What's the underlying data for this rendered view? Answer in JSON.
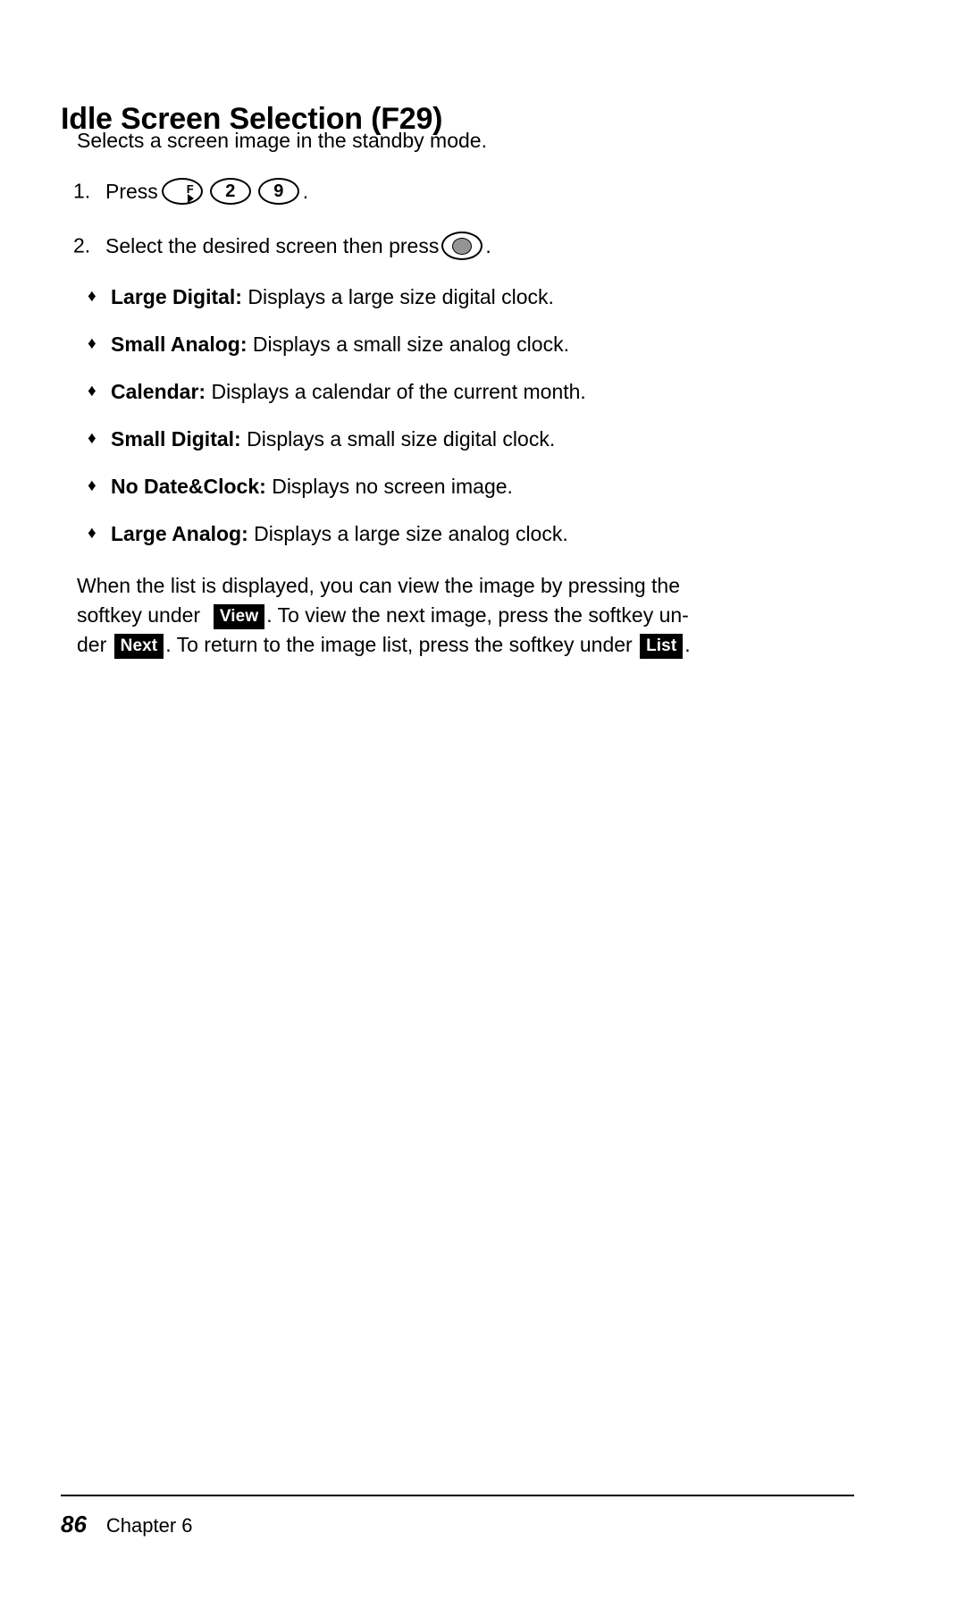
{
  "document": {
    "title": "Idle Screen Selection (F29)",
    "intro": "Selects a screen image in the standby mode."
  },
  "steps": [
    {
      "number": "1.",
      "lead": "Press",
      "keys": [
        {
          "icon": "func-key-icon",
          "label": "F",
          "has_arrow": true
        },
        {
          "icon": "number-key-2-icon",
          "label": "2",
          "has_arrow": false
        },
        {
          "icon": "number-key-9-icon",
          "label": "9",
          "has_arrow": false
        }
      ],
      "tail": "."
    },
    {
      "number": "2.",
      "lead": "Select the desired screen then press",
      "round_key": "select-round-key-icon",
      "tail": "."
    }
  ],
  "options": [
    {
      "bullet": "♦",
      "term": "Large Digital:",
      "desc": " Displays a large size digital clock."
    },
    {
      "bullet": "♦",
      "term": "Small Analog:",
      "desc": " Displays a small size analog clock."
    },
    {
      "bullet": "♦",
      "term": "Calendar:",
      "desc": " Displays a calendar of the current month."
    },
    {
      "bullet": "♦",
      "term": "Small Digital:",
      "desc": " Displays a small size digital clock."
    },
    {
      "bullet": "♦",
      "term": "No Date&Clock:",
      "desc": " Displays no screen image."
    },
    {
      "bullet": "♦",
      "term": "Large Analog:",
      "desc": " Displays a large size analog clock."
    }
  ],
  "paragraph": {
    "line1": "When the list is displayed, you can view the image by pressing the",
    "line2a": "softkey under",
    "softkey_view": "View",
    "line2b": ". To view the next image, press the softkey un-",
    "line3a": "der",
    "softkey_next": "Next",
    "line3b": ". To return to the image list, press the softkey under",
    "softkey_list": "List",
    "line3c": "."
  },
  "footer": {
    "page_number": "86",
    "chapter": "Chapter 6"
  }
}
